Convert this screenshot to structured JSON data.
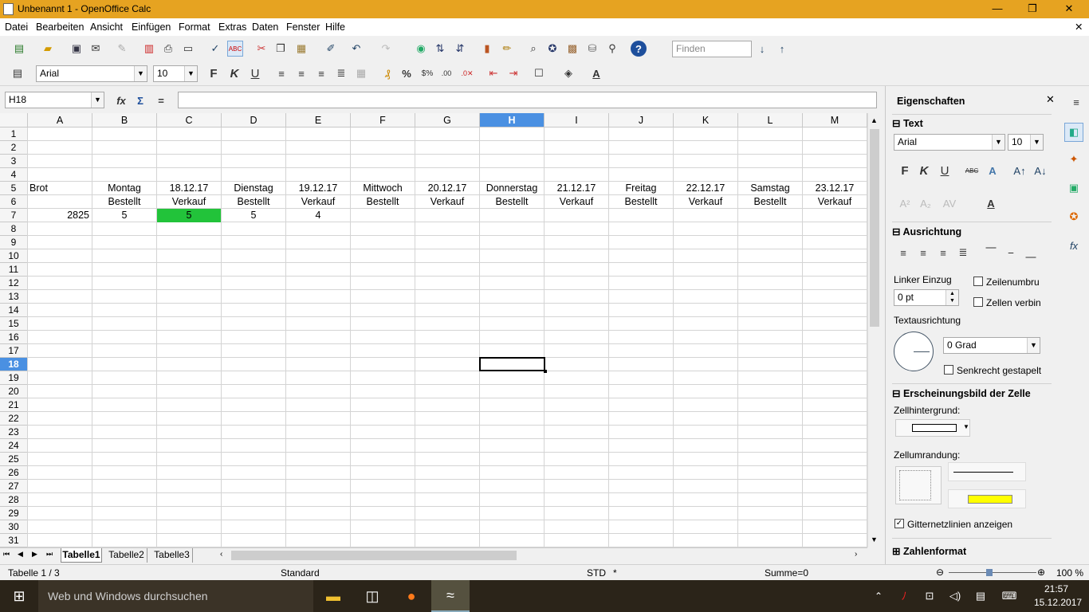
{
  "window": {
    "title": "Unbenannt 1 - OpenOffice Calc",
    "minimize": "—",
    "maximize": "❐",
    "close": "✕"
  },
  "menu": [
    "Datei",
    "Bearbeiten",
    "Ansicht",
    "Einfügen",
    "Format",
    "Extras",
    "Daten",
    "Fenster",
    "Hilfe"
  ],
  "toolbar": {
    "find_placeholder": "Finden",
    "font_name": "Arial",
    "font_size": "10"
  },
  "formula": {
    "cell_ref": "H18",
    "content": ""
  },
  "columns": [
    "A",
    "B",
    "C",
    "D",
    "E",
    "F",
    "G",
    "H",
    "I",
    "J",
    "K",
    "L",
    "M"
  ],
  "selected_col": "H",
  "selected_row": "18",
  "rows": [
    "1",
    "2",
    "3",
    "4",
    "5",
    "6",
    "7",
    "8",
    "9",
    "10",
    "11",
    "12",
    "13",
    "14",
    "15",
    "16",
    "17",
    "18",
    "19",
    "20",
    "21",
    "22",
    "23",
    "24",
    "25",
    "26",
    "27",
    "28",
    "29",
    "30",
    "31"
  ],
  "cells": {
    "r5": [
      "Brot",
      "Montag",
      "18.12.17",
      "Dienstag",
      "19.12.17",
      "Mittwoch",
      "20.12.17",
      "Donnerstag",
      "21.12.17",
      "Freitag",
      "22.12.17",
      "Samstag",
      "23.12.17"
    ],
    "r6": [
      "",
      "Bestellt",
      "Verkauf",
      "Bestellt",
      "Verkauf",
      "Bestellt",
      "Verkauf",
      "Bestellt",
      "Verkauf",
      "Bestellt",
      "Verkauf",
      "Bestellt",
      "Verkauf"
    ],
    "r7": [
      "2825",
      "5",
      "5",
      "5",
      "4",
      "",
      "",
      "",
      "",
      "",
      "",
      "",
      ""
    ]
  },
  "highlight_color": "#22c33a",
  "sheets": [
    "Tabelle1",
    "Tabelle2",
    "Tabelle3"
  ],
  "status": {
    "sheet": "Tabelle 1 / 3",
    "style": "Standard",
    "mode": "STD",
    "modified": "*",
    "sum": "Summe=0",
    "zoom": "100 %"
  },
  "sidebar": {
    "title": "Eigenschaften",
    "text_section": "Text",
    "font": "Arial",
    "size": "10",
    "align_section": "Ausrichtung",
    "indent_label": "Linker Einzug",
    "indent_value": "0 pt",
    "wrap": "Zeilenumbru",
    "merge": "Zellen verbin",
    "orientation_label": "Textausrichtung",
    "orientation_value": "0 Grad",
    "stacked": "Senkrecht gestapelt",
    "appearance_section": "Erscheinungsbild der Zelle",
    "bg_label": "Zellhintergrund:",
    "border_label": "Zellumrandung:",
    "gridlines": "Gitternetzlinien anzeigen",
    "numformat_section": "Zahlenformat"
  },
  "taskbar": {
    "search": "Web und Windows durchsuchen",
    "time": "21:57",
    "date": "15.12.2017"
  }
}
